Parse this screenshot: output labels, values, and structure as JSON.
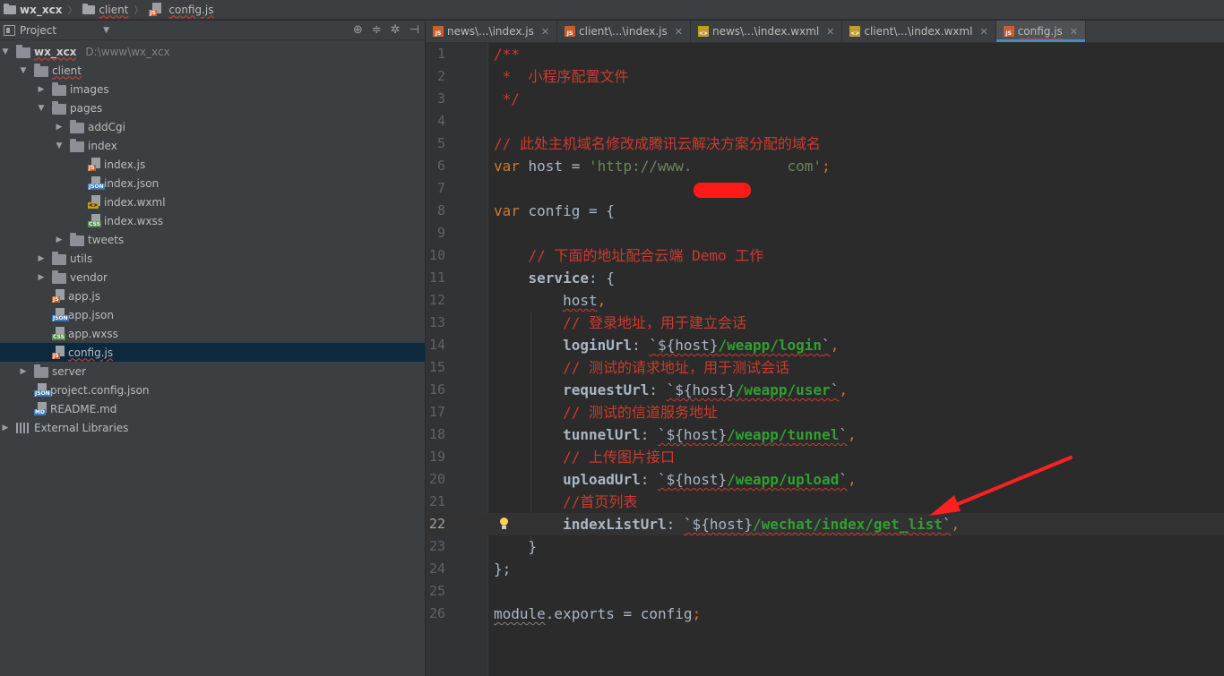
{
  "breadcrumb": {
    "items": [
      {
        "label": "wx_xcx",
        "icon": "folder-icon"
      },
      {
        "label": "client",
        "icon": "folder-icon"
      },
      {
        "label": "config.js",
        "icon": "js-file-icon"
      }
    ]
  },
  "project_panel": {
    "title": "Project",
    "tree": [
      {
        "label": "wx_xcx",
        "hint": "D:\\www\\wx_xcx",
        "type": "folder",
        "expanded": true,
        "depth": 0
      },
      {
        "label": "client",
        "type": "folder",
        "expanded": true,
        "depth": 1
      },
      {
        "label": "images",
        "type": "folder",
        "expanded": false,
        "depth": 2
      },
      {
        "label": "pages",
        "type": "folder",
        "expanded": true,
        "depth": 2
      },
      {
        "label": "addCgi",
        "type": "folder",
        "expanded": false,
        "depth": 3
      },
      {
        "label": "index",
        "type": "folder",
        "expanded": true,
        "depth": 3
      },
      {
        "label": "index.js",
        "type": "js",
        "depth": 4
      },
      {
        "label": "index.json",
        "type": "json",
        "depth": 4
      },
      {
        "label": "index.wxml",
        "type": "wxml",
        "depth": 4
      },
      {
        "label": "index.wxss",
        "type": "css",
        "depth": 4
      },
      {
        "label": "tweets",
        "type": "folder",
        "expanded": false,
        "depth": 3
      },
      {
        "label": "utils",
        "type": "folder",
        "expanded": false,
        "depth": 2
      },
      {
        "label": "vendor",
        "type": "folder",
        "expanded": false,
        "depth": 2
      },
      {
        "label": "app.js",
        "type": "js",
        "depth": 2
      },
      {
        "label": "app.json",
        "type": "json",
        "depth": 2
      },
      {
        "label": "app.wxss",
        "type": "css",
        "depth": 2
      },
      {
        "label": "config.js",
        "type": "js",
        "depth": 2,
        "selected": true
      },
      {
        "label": "server",
        "type": "folder",
        "expanded": false,
        "depth": 1
      },
      {
        "label": "project.config.json",
        "type": "json",
        "depth": 1
      },
      {
        "label": "README.md",
        "type": "md",
        "depth": 1
      },
      {
        "label": "External Libraries",
        "type": "lib",
        "expanded": false,
        "depth": 0
      }
    ]
  },
  "tabs": [
    {
      "label": "news\\...\\index.js",
      "icon": "js-file-icon",
      "active": false
    },
    {
      "label": "client\\...\\index.js",
      "icon": "js-file-icon",
      "active": false
    },
    {
      "label": "news\\...\\index.wxml",
      "icon": "wxml-file-icon",
      "active": false
    },
    {
      "label": "client\\...\\index.wxml",
      "icon": "wxml-file-icon",
      "active": false
    },
    {
      "label": "config.js",
      "icon": "js-file-icon",
      "active": true
    }
  ],
  "editor": {
    "current_line": 22,
    "lines": [
      {
        "n": "1",
        "segs": [
          {
            "t": "/**",
            "c": "comment"
          }
        ]
      },
      {
        "n": "2",
        "segs": [
          {
            "t": " *  小程序配置文件",
            "c": "comment"
          }
        ]
      },
      {
        "n": "3",
        "segs": [
          {
            "t": " */",
            "c": "comment"
          }
        ]
      },
      {
        "n": "4",
        "segs": []
      },
      {
        "n": "5",
        "segs": [
          {
            "t": "// 此处主机域名修改成腾讯云解决方案分配的域名",
            "c": "comment"
          }
        ]
      },
      {
        "n": "6",
        "segs": [
          {
            "t": "var",
            "c": "kw"
          },
          {
            "t": " host = ",
            "c": "plain"
          },
          {
            "t": "'http://www.",
            "c": "str"
          },
          {
            "t": "           ",
            "c": "str"
          },
          {
            "t": "com'",
            "c": "str"
          },
          {
            "t": ";",
            "c": "kw"
          }
        ]
      },
      {
        "n": "7",
        "segs": []
      },
      {
        "n": "8",
        "segs": [
          {
            "t": "var",
            "c": "kw"
          },
          {
            "t": " config = {",
            "c": "plain"
          }
        ]
      },
      {
        "n": "9",
        "segs": []
      },
      {
        "n": "10",
        "segs": [
          {
            "t": "    // 下面的地址配合云端 Demo 工作",
            "c": "comment"
          }
        ]
      },
      {
        "n": "11",
        "segs": [
          {
            "t": "    ",
            "c": "plain"
          },
          {
            "t": "service",
            "c": "prop"
          },
          {
            "t": ": {",
            "c": "plain"
          }
        ]
      },
      {
        "n": "12",
        "segs": [
          {
            "t": "        ",
            "c": "plain"
          },
          {
            "t": "host",
            "c": "plain",
            "u": "red"
          },
          {
            "t": ",",
            "c": "kw"
          }
        ]
      },
      {
        "n": "13",
        "segs": [
          {
            "t": "        // 登录地址，用于建立会话",
            "c": "comment"
          }
        ]
      },
      {
        "n": "14",
        "segs": [
          {
            "t": "        ",
            "c": "plain"
          },
          {
            "t": "loginUrl",
            "c": "prop"
          },
          {
            "t": ": ",
            "c": "plain"
          },
          {
            "t": "`${host}",
            "c": "tpl",
            "u": "red"
          },
          {
            "t": "/weapp/login",
            "c": "strg",
            "u": "red"
          },
          {
            "t": "`",
            "c": "tpl",
            "u": "red"
          },
          {
            "t": ",",
            "c": "kw"
          }
        ]
      },
      {
        "n": "15",
        "segs": [
          {
            "t": "        // 测试的请求地址，用于测试会话",
            "c": "comment"
          }
        ]
      },
      {
        "n": "16",
        "segs": [
          {
            "t": "        ",
            "c": "plain"
          },
          {
            "t": "requestUrl",
            "c": "prop"
          },
          {
            "t": ": ",
            "c": "plain"
          },
          {
            "t": "`${host}",
            "c": "tpl",
            "u": "red"
          },
          {
            "t": "/weapp/user",
            "c": "strg",
            "u": "red"
          },
          {
            "t": "`",
            "c": "tpl",
            "u": "red"
          },
          {
            "t": ",",
            "c": "kw"
          }
        ]
      },
      {
        "n": "17",
        "segs": [
          {
            "t": "        // 测试的信道服务地址",
            "c": "comment"
          }
        ]
      },
      {
        "n": "18",
        "segs": [
          {
            "t": "        ",
            "c": "plain"
          },
          {
            "t": "tunnelUrl",
            "c": "prop"
          },
          {
            "t": ": ",
            "c": "plain"
          },
          {
            "t": "`${host}",
            "c": "tpl",
            "u": "red"
          },
          {
            "t": "/weapp/tunnel",
            "c": "strg",
            "u": "red"
          },
          {
            "t": "`",
            "c": "tpl",
            "u": "red"
          },
          {
            "t": ",",
            "c": "kw"
          }
        ]
      },
      {
        "n": "19",
        "segs": [
          {
            "t": "        // 上传图片接口",
            "c": "comment"
          }
        ]
      },
      {
        "n": "20",
        "segs": [
          {
            "t": "        ",
            "c": "plain"
          },
          {
            "t": "uploadUrl",
            "c": "prop"
          },
          {
            "t": ": ",
            "c": "plain"
          },
          {
            "t": "`${host}",
            "c": "tpl",
            "u": "red"
          },
          {
            "t": "/weapp/upload",
            "c": "strg",
            "u": "red"
          },
          {
            "t": "`",
            "c": "tpl",
            "u": "red"
          },
          {
            "t": ",",
            "c": "kw"
          }
        ]
      },
      {
        "n": "21",
        "segs": [
          {
            "t": "        //首页列表",
            "c": "comment"
          }
        ]
      },
      {
        "n": "22",
        "segs": [
          {
            "t": "        ",
            "c": "plain"
          },
          {
            "t": "indexListUrl",
            "c": "prop"
          },
          {
            "t": ": ",
            "c": "plain"
          },
          {
            "t": "`${host}",
            "c": "tpl",
            "u": "red"
          },
          {
            "t": "/wechat/index/get_list",
            "c": "strg",
            "u": "red"
          },
          {
            "t": "`",
            "c": "tpl",
            "u": "red"
          },
          {
            "t": ",",
            "c": "kw"
          }
        ]
      },
      {
        "n": "23",
        "segs": [
          {
            "t": "    }",
            "c": "plain"
          }
        ]
      },
      {
        "n": "24",
        "segs": [
          {
            "t": "};",
            "c": "plain"
          }
        ]
      },
      {
        "n": "25",
        "segs": []
      },
      {
        "n": "26",
        "segs": [
          {
            "t": "module",
            "c": "plain",
            "u": "grey"
          },
          {
            "t": ".exports",
            "c": "plain"
          },
          {
            "t": " = ",
            "c": "plain"
          },
          {
            "t": "config",
            "c": "plain"
          },
          {
            "t": ";",
            "c": "kw"
          }
        ]
      }
    ]
  },
  "colors": {
    "comment": "#cc3b2f",
    "keyword": "#cc7832",
    "string": "#6a8759",
    "template_path": "#30a030",
    "selection": "#0d293e",
    "annotation_arrow": "#ff2020"
  }
}
